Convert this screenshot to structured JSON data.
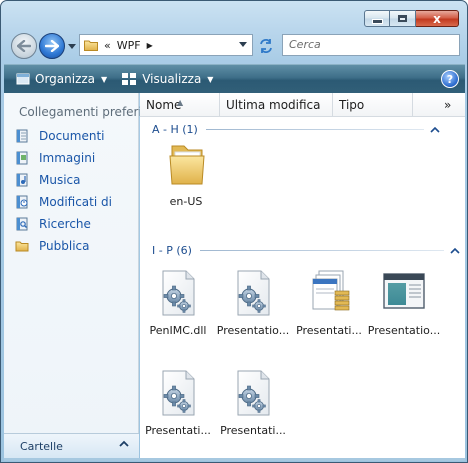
{
  "window": {
    "close_glyph": "x"
  },
  "address": {
    "prefix": "«",
    "crumb": "WPF",
    "separator": "▶"
  },
  "search": {
    "placeholder": "Cerca"
  },
  "commandbar": {
    "organize_label": "Organizza",
    "view_label": "Visualizza",
    "help_label": "?"
  },
  "favorites": {
    "title": "Collegamenti preferiti",
    "items": [
      {
        "label": "Documenti",
        "icon": "documents-icon"
      },
      {
        "label": "Immagini",
        "icon": "pictures-icon"
      },
      {
        "label": "Musica",
        "icon": "music-icon"
      },
      {
        "label": "Modificati di",
        "icon": "recently-changed-icon"
      },
      {
        "label": "Ricerche",
        "icon": "searches-icon"
      },
      {
        "label": "Pubblica",
        "icon": "public-folder-icon"
      }
    ]
  },
  "folders_bar": {
    "label": "Cartelle"
  },
  "columns": {
    "name": "Nome",
    "modified": "Ultima modifica",
    "type": "Tipo",
    "more": "»"
  },
  "groups": [
    {
      "label": "A - H (1)",
      "files": [
        {
          "name": "en-US",
          "icon": "folder-icon"
        }
      ]
    },
    {
      "label": "I - P (6)",
      "files": [
        {
          "name": "PenIMC.dll",
          "icon": "dll-file-icon"
        },
        {
          "name": "Presentatio...",
          "icon": "dll-file-icon"
        },
        {
          "name": "Presentati...",
          "icon": "assembly-stack-icon"
        },
        {
          "name": "Presentatio...",
          "icon": "application-window-icon"
        },
        {
          "name": "Presentati...",
          "icon": "dll-file-icon"
        },
        {
          "name": "Presentati...",
          "icon": "dll-file-icon"
        }
      ]
    }
  ],
  "colors": {
    "link_blue": "#1a56a8",
    "group_blue": "#1d4d8f",
    "commandbar": "#3e6e88"
  }
}
